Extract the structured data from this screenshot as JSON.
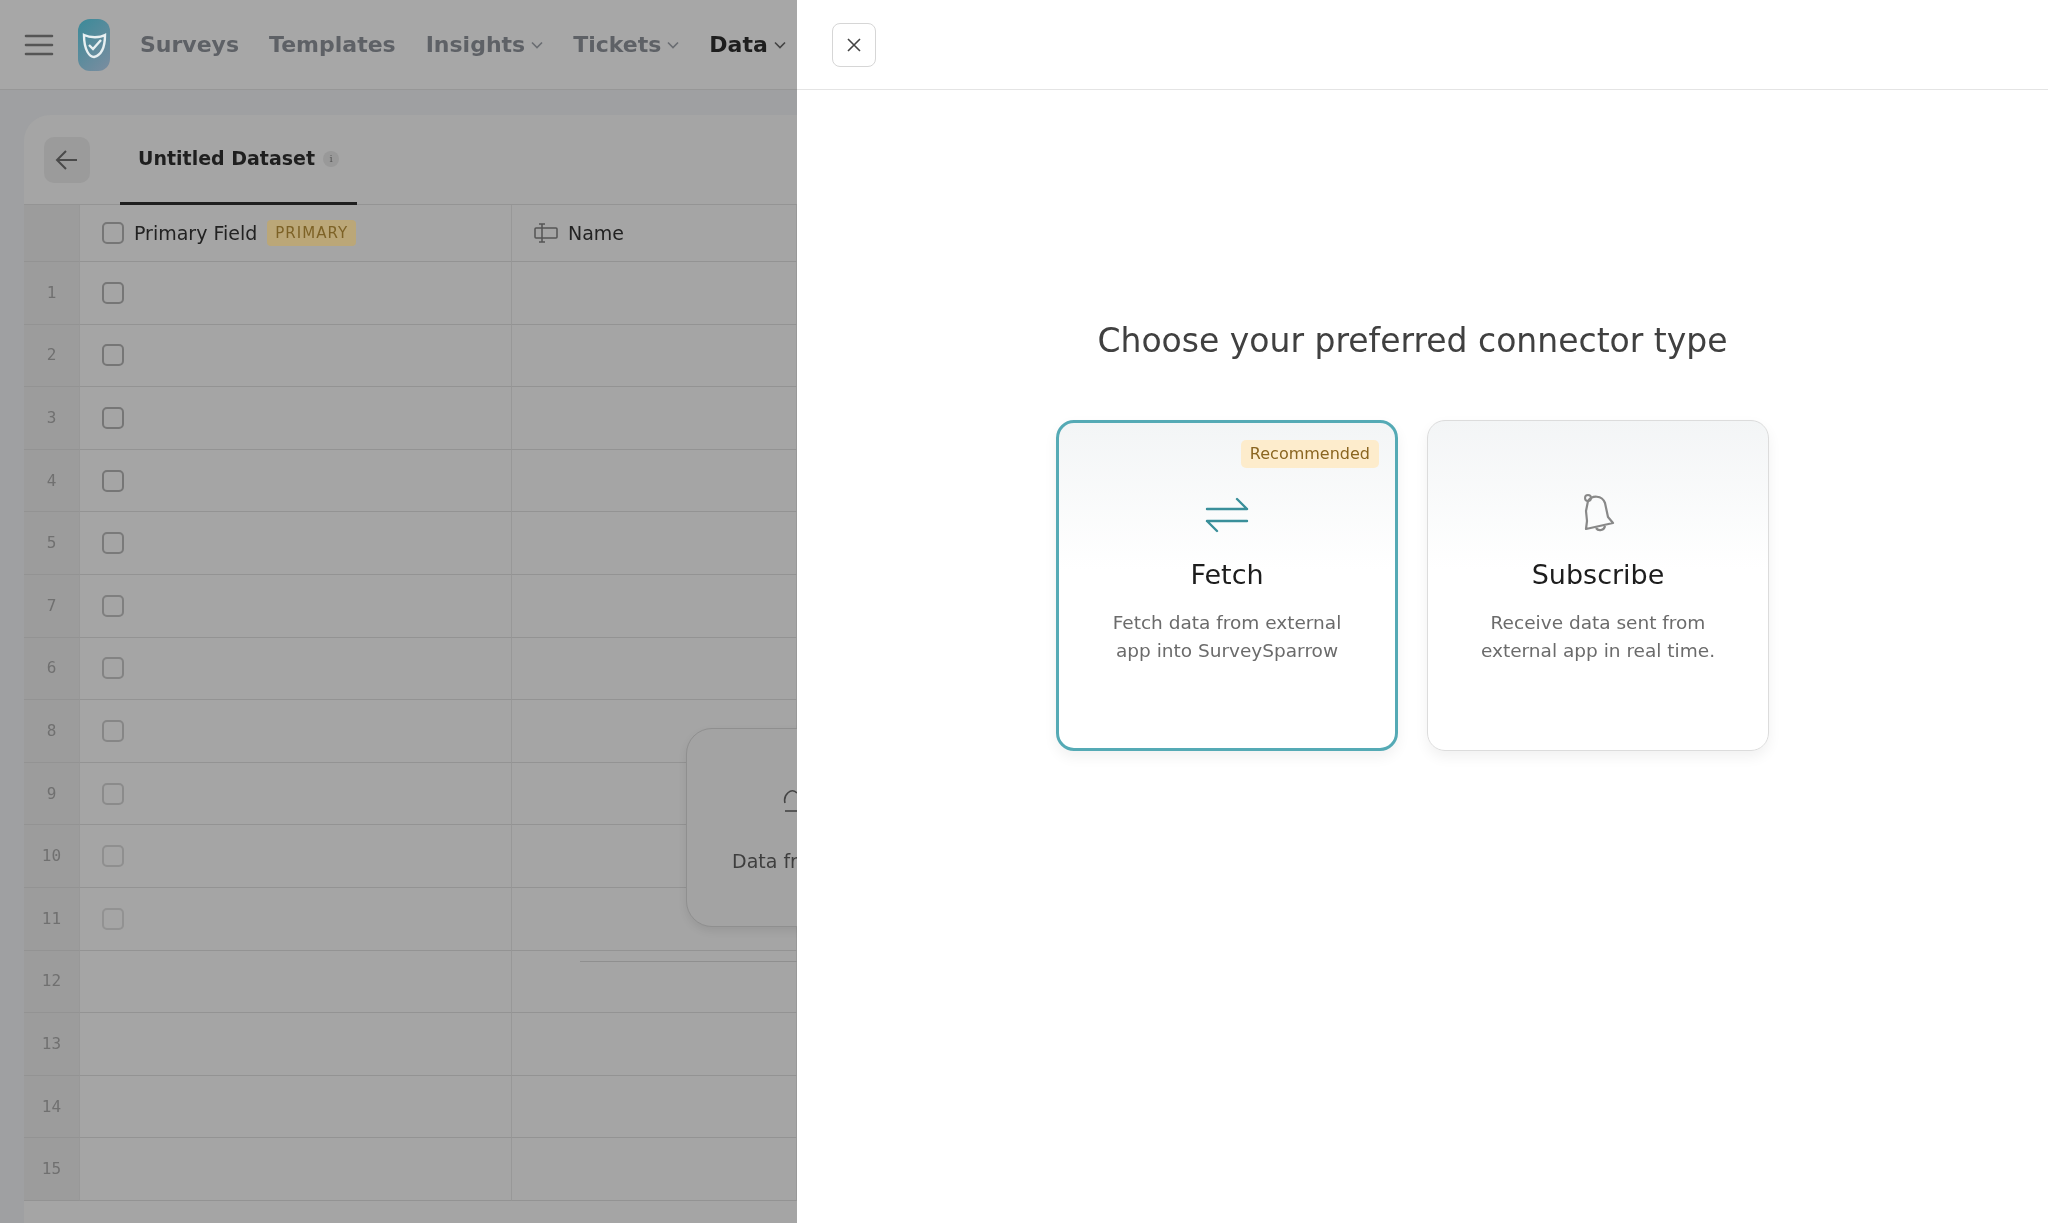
{
  "nav": {
    "items": [
      {
        "label": "Surveys",
        "dropdown": false,
        "selected": false
      },
      {
        "label": "Templates",
        "dropdown": false,
        "selected": false
      },
      {
        "label": "Insights",
        "dropdown": true,
        "selected": false
      },
      {
        "label": "Tickets",
        "dropdown": true,
        "selected": false
      },
      {
        "label": "Data",
        "dropdown": true,
        "selected": true
      }
    ]
  },
  "dataset": {
    "title": "Untitled Dataset",
    "info": "i"
  },
  "table": {
    "select_all_checked": false,
    "columns": [
      {
        "label": "Primary Field",
        "badge": "PRIMARY",
        "kind": "primary"
      },
      {
        "label": "Name",
        "kind": "text"
      }
    ],
    "rows": [
      {
        "number": "1",
        "kind": "record",
        "checked": false
      },
      {
        "number": "2",
        "kind": "record",
        "checked": false
      },
      {
        "number": "3",
        "kind": "record",
        "checked": false
      },
      {
        "number": "4",
        "kind": "record",
        "checked": false
      },
      {
        "number": "5",
        "kind": "record",
        "checked": false
      },
      {
        "number": "7",
        "kind": "record",
        "checked": false
      },
      {
        "number": "6",
        "kind": "record",
        "checked": false
      },
      {
        "number": "8",
        "kind": "record",
        "checked": false
      },
      {
        "number": "9",
        "kind": "record",
        "checked": false
      },
      {
        "number": "10",
        "kind": "record",
        "checked": false
      },
      {
        "number": "11",
        "kind": "record",
        "checked": false
      },
      {
        "number": "12",
        "kind": "blank"
      },
      {
        "number": "13",
        "kind": "blank"
      },
      {
        "number": "14",
        "kind": "blank"
      },
      {
        "number": "15",
        "kind": "blank"
      }
    ]
  },
  "background_card": {
    "label": "Data fr"
  },
  "panel": {
    "title": "Choose your preferred connector type",
    "options": [
      {
        "kind": "fetch",
        "title": "Fetch",
        "description": "Fetch data from external app into SurveySparrow",
        "badge": "Recommended",
        "selected": true
      },
      {
        "kind": "subscribe",
        "title": "Subscribe",
        "description": "Receive data sent from external app in real time.",
        "selected": false
      }
    ]
  }
}
